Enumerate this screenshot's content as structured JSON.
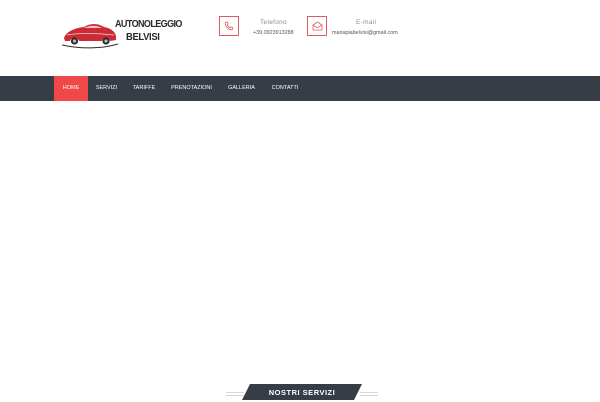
{
  "brand": {
    "line1": "AUTONOLEGGIO",
    "line2": "BELVISI"
  },
  "contacts": [
    {
      "label": "Telefono",
      "value": "+39.0923913288",
      "icon": "phone-icon"
    },
    {
      "label": "E-mail",
      "value": "mariapiabelvisi@gmail.com",
      "icon": "envelope-icon"
    }
  ],
  "nav": {
    "items": [
      {
        "label": "HOME",
        "active": true
      },
      {
        "label": "SERVIZI",
        "active": false
      },
      {
        "label": "TARIFFE",
        "active": false
      },
      {
        "label": "PRENOTAZIONI",
        "active": false
      },
      {
        "label": "GALLERIA",
        "active": false
      },
      {
        "label": "CONTATTI",
        "active": false
      }
    ]
  },
  "section": {
    "title": "NOSTRI SERVIZI"
  },
  "colors": {
    "accent": "#f04848",
    "nav_bg": "#363d47",
    "ribbon_bg": "#363d47"
  }
}
